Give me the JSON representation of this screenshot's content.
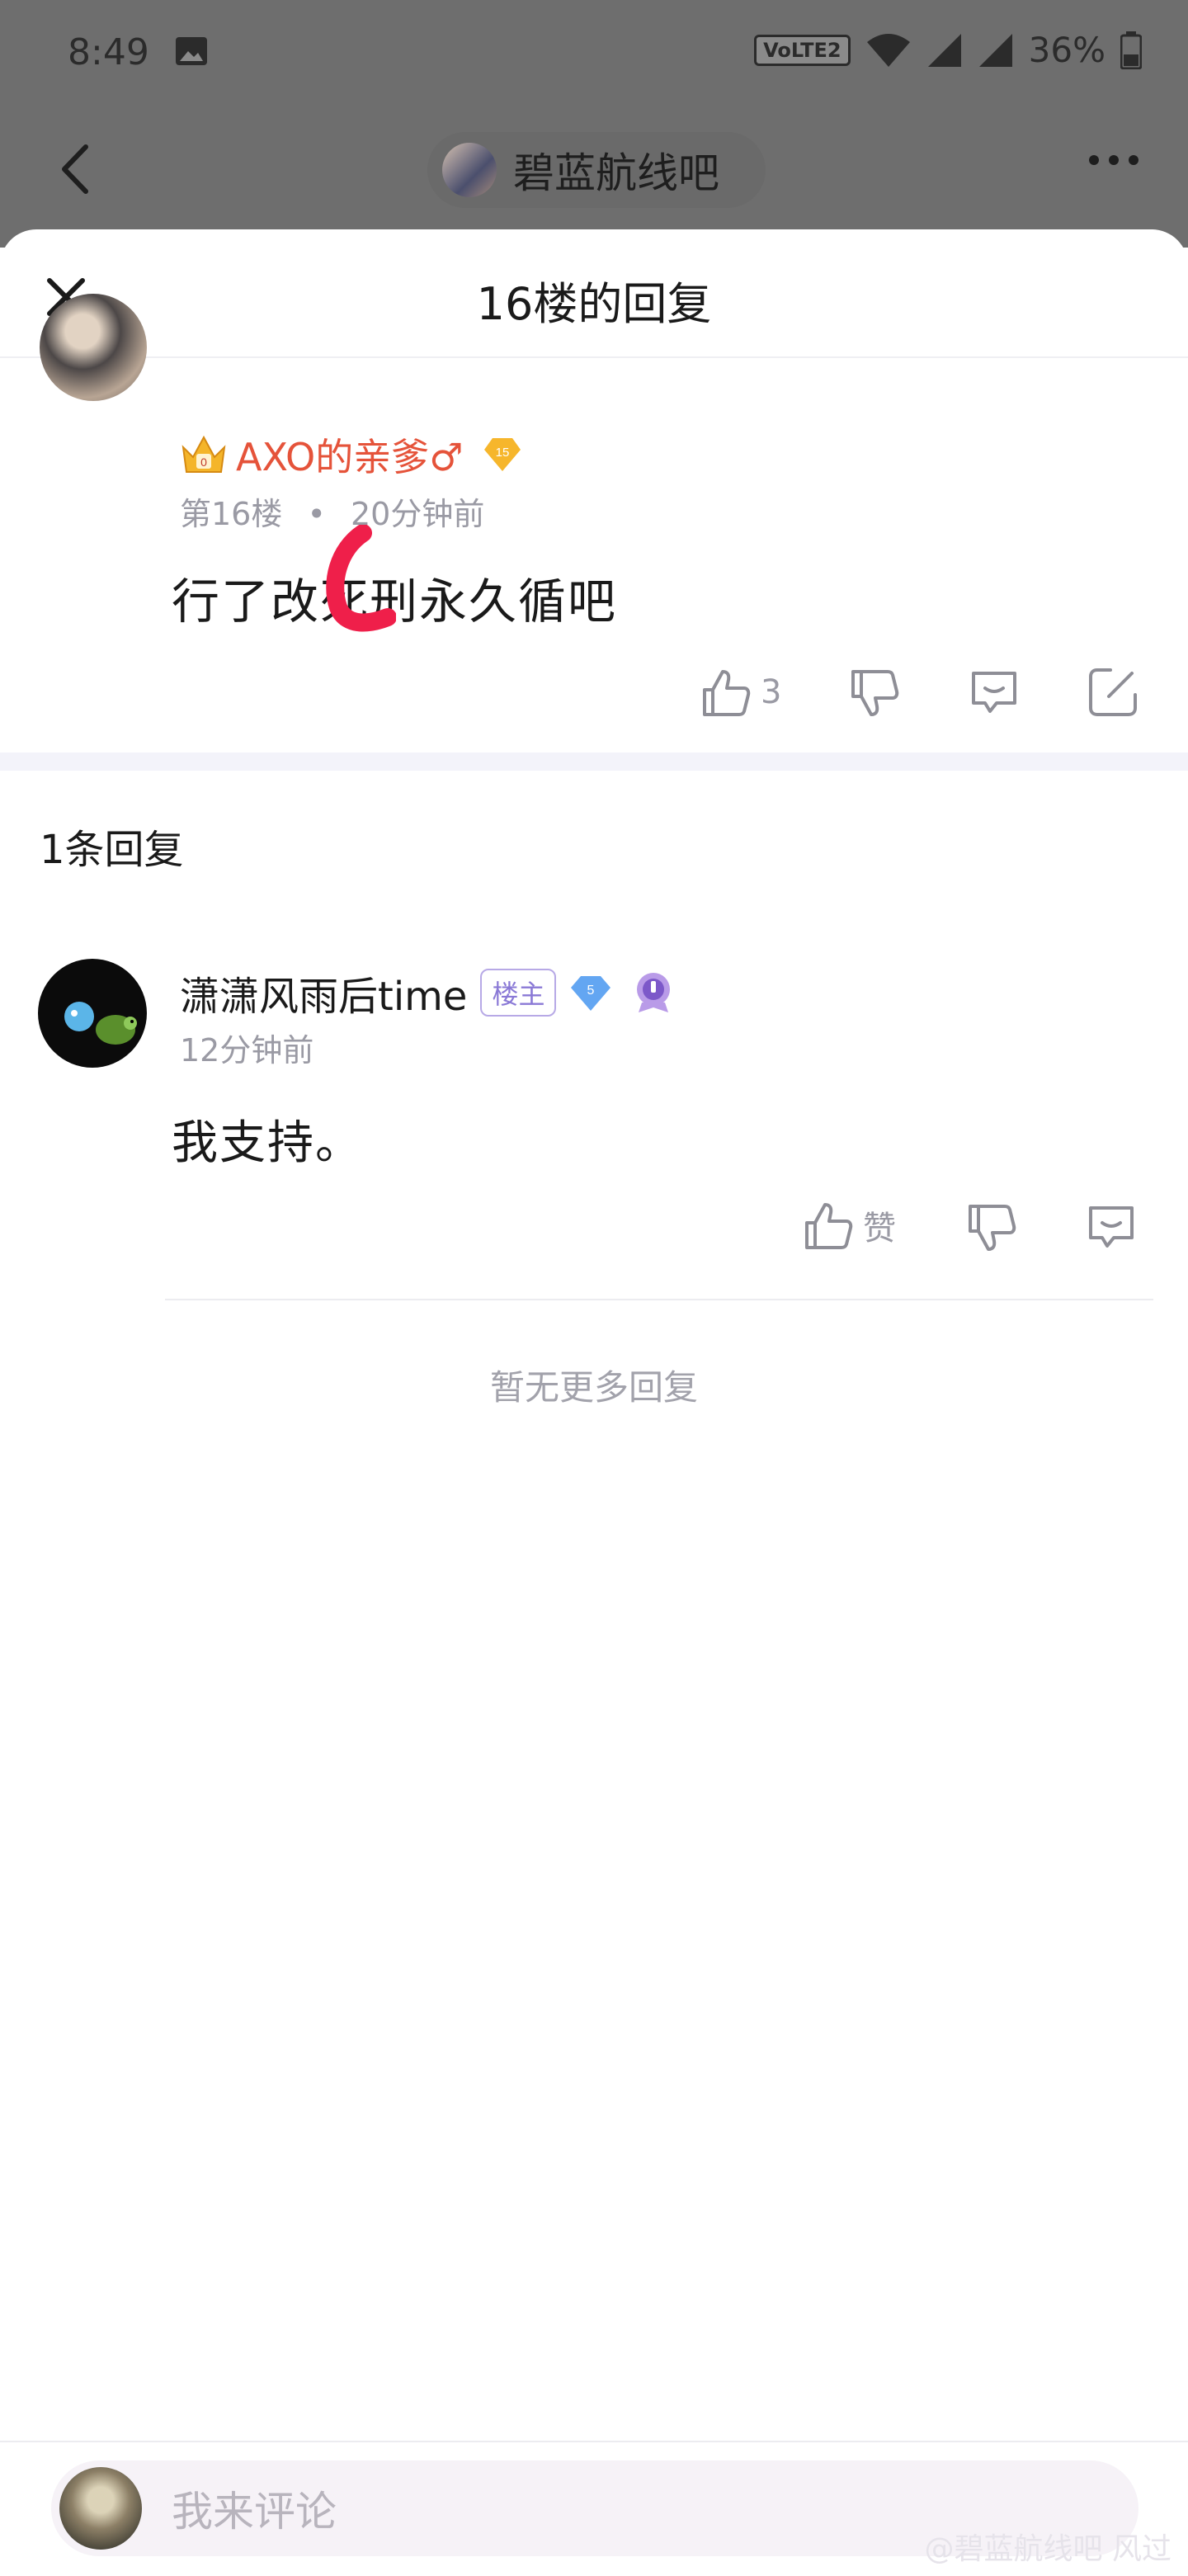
{
  "status_bar": {
    "time": "8:49",
    "network_badge": "VoLTE2",
    "battery": "36%"
  },
  "top_header": {
    "forum_name": "碧蓝航线吧"
  },
  "sheet": {
    "title": "16楼的回复"
  },
  "post": {
    "author": "AXO的亲爹♂",
    "level": "15",
    "floor": "第16楼",
    "separator": "•",
    "time": "20分钟前",
    "text": "行了改死刑永久循吧",
    "like_count": "3"
  },
  "replies": {
    "count_label": "1条回复",
    "items": [
      {
        "author": "潇潇风雨后time",
        "badge": "楼主",
        "level": "5",
        "time": "12分钟前",
        "text": "我支持。",
        "like_label": "赞"
      }
    ],
    "end_label": "暂无更多回复"
  },
  "footer": {
    "placeholder": "我来评论",
    "watermark": "@碧蓝航线吧 风过"
  },
  "colors": {
    "author_red": "#e5533a",
    "mod_purple": "#8a79d6",
    "meta_gray": "#9a9aa4",
    "band": "#f3f3fa"
  }
}
